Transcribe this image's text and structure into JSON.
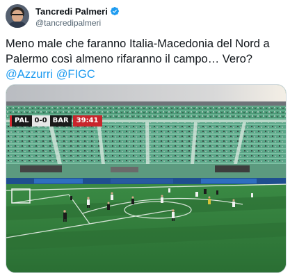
{
  "author": {
    "display_name": "Tancredi Palmeri",
    "handle": "@tancredipalmeri",
    "verified_icon": "verified-badge-icon",
    "avatar_icon": "avatar-photo"
  },
  "tweet": {
    "line1": "Meno male che faranno Italia-Macedonia del Nord a",
    "line2": "Palermo così almeno rifaranno il campo… Vero?",
    "mention1": "@Azzurri",
    "mention2": "@FIGC"
  },
  "media": {
    "scoreboard": {
      "home": "PAL",
      "score": "0-0",
      "away": "BAR",
      "clock": "39:41"
    }
  },
  "colors": {
    "link": "#1d9bf0",
    "text": "#0f1419",
    "secondary": "#536471",
    "verified": "#1d9bf0",
    "pitch": "#2f7a3b"
  }
}
